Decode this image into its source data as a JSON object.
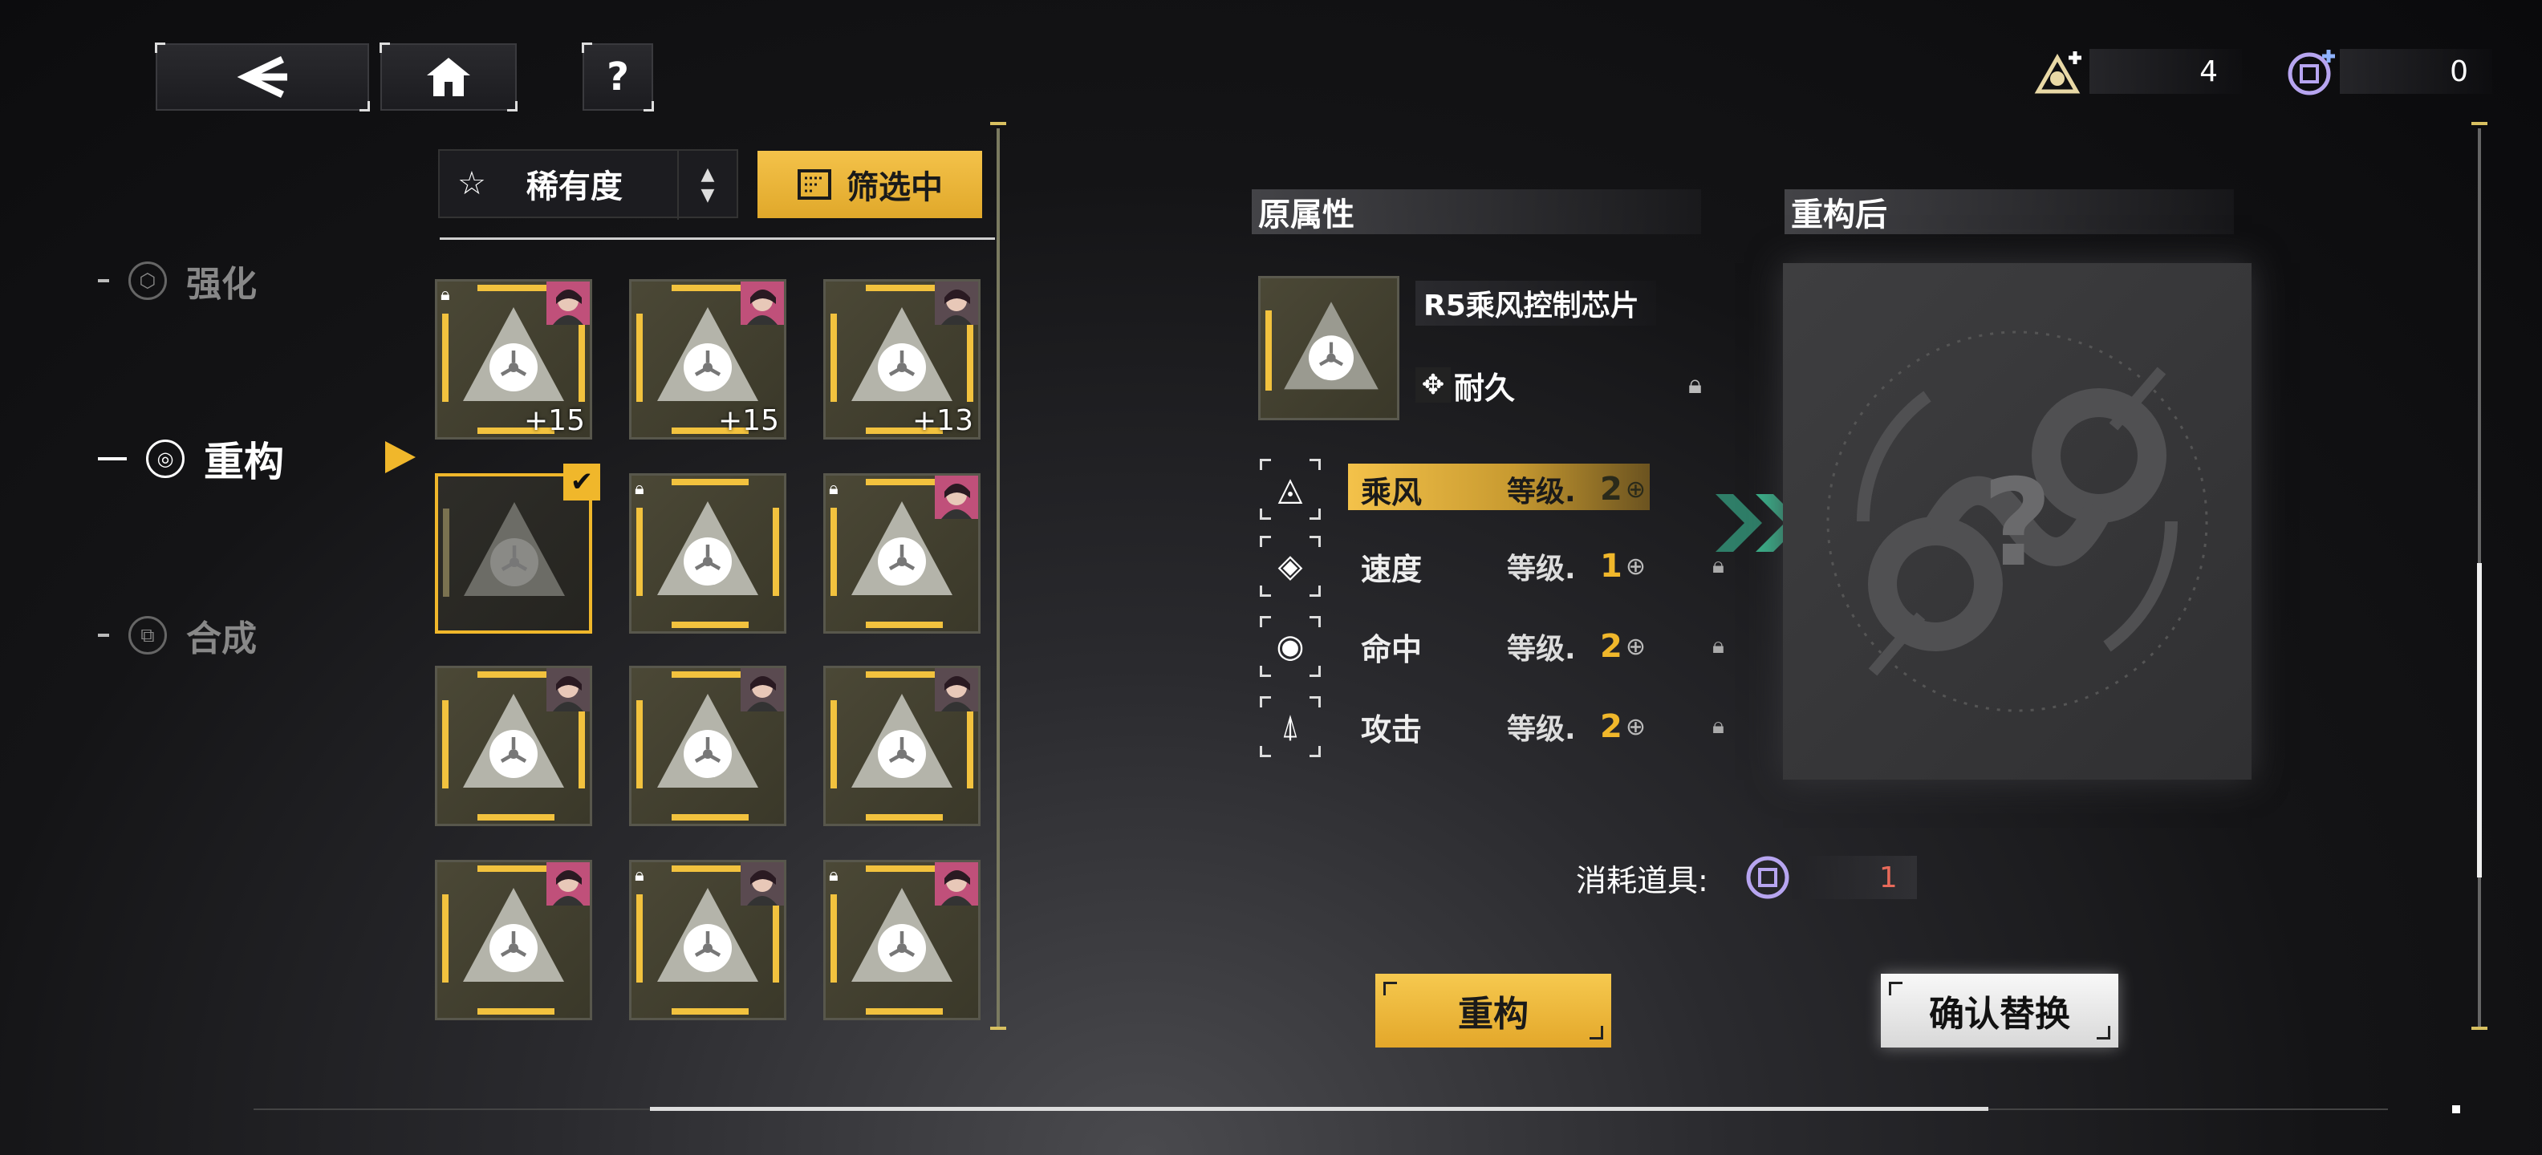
{
  "nav": {
    "back_icon": "back-arrow-icon",
    "home_icon": "home-icon",
    "help_label": "?"
  },
  "currency": [
    {
      "icon": "material-icon",
      "value": "4"
    },
    {
      "icon": "reforge-token-icon",
      "value": "0"
    }
  ],
  "sidebar": {
    "items": [
      {
        "label": "强化",
        "icon": "enhance-icon",
        "active": false
      },
      {
        "label": "重构",
        "icon": "reforge-icon",
        "active": true
      },
      {
        "label": "合成",
        "icon": "synthesis-icon",
        "active": false
      }
    ]
  },
  "filter": {
    "sort_label": "稀有度",
    "filter_label": "筛选中"
  },
  "grid": {
    "cards": [
      {
        "level": "+15",
        "locked": true
      },
      {
        "level": "+15",
        "locked": false
      },
      {
        "level": "+13",
        "locked": false
      },
      {
        "level": "",
        "locked": false,
        "selected": true
      },
      {
        "level": "",
        "locked": true
      },
      {
        "level": "",
        "locked": true
      },
      {
        "level": "",
        "locked": false
      },
      {
        "level": "",
        "locked": false
      },
      {
        "level": "",
        "locked": false
      },
      {
        "level": "",
        "locked": false
      },
      {
        "level": "",
        "locked": true
      },
      {
        "level": "",
        "locked": true
      }
    ]
  },
  "original": {
    "header": "原属性",
    "chip_name": "R5乘风控制芯片",
    "main_stat": "耐久",
    "level_prefix": "等级.",
    "stats": [
      {
        "name": "乘风",
        "level": "2",
        "highlighted": true
      },
      {
        "name": "速度",
        "level": "1",
        "highlighted": false
      },
      {
        "name": "命中",
        "level": "2",
        "highlighted": false
      },
      {
        "name": "攻击",
        "level": "2",
        "highlighted": false
      }
    ]
  },
  "reforged": {
    "header": "重构后",
    "unknown": "?"
  },
  "cost": {
    "label": "消耗道具:",
    "value": "1"
  },
  "buttons": {
    "reforge": "重构",
    "confirm": "确认替换"
  },
  "colors": {
    "accent": "#f0b72b",
    "arrow": "#4fd6a8",
    "cost_value": "#e86a5a"
  }
}
